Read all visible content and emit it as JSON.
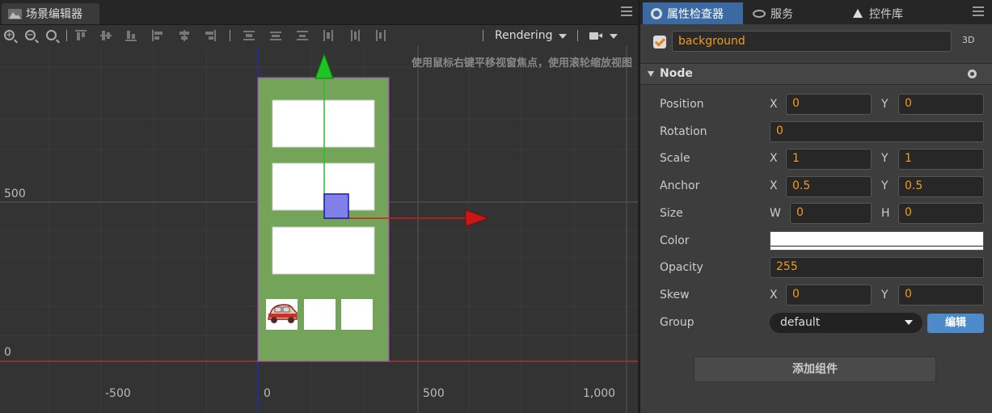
{
  "scene_panel": {
    "tab_label": "场景编辑器",
    "rendering_label": "Rendering",
    "hint": "使用鼠标右键平移视窗焦点，使用滚轮缩放视图",
    "axis": {
      "y_labels": [
        "500",
        "0"
      ],
      "x_labels": [
        "-500",
        "0",
        "500",
        "1,000"
      ]
    },
    "colors": {
      "grid_bg": "#333333",
      "background_node": "#73a45a",
      "x_axis": "#d11a1a",
      "y_axis": "#25c42b"
    }
  },
  "inspector": {
    "tabs": [
      {
        "label": "属性检查器",
        "icon": "gear-icon"
      },
      {
        "label": "服务",
        "icon": "eye-icon"
      },
      {
        "label": "控件库",
        "icon": "triangle-icon"
      }
    ],
    "node_name": "background",
    "tag_3d": "3D",
    "section_title": "Node",
    "props": {
      "position": {
        "label": "Position",
        "x": "0",
        "y": "0"
      },
      "rotation": {
        "label": "Rotation",
        "value": "0"
      },
      "scale": {
        "label": "Scale",
        "x": "1",
        "y": "1"
      },
      "anchor": {
        "label": "Anchor",
        "x": "0.5",
        "y": "0.5"
      },
      "size": {
        "label": "Size",
        "w": "0",
        "h": "0"
      },
      "color": {
        "label": "Color",
        "value": "#ffffff"
      },
      "opacity": {
        "label": "Opacity",
        "value": "255"
      },
      "skew": {
        "label": "Skew",
        "x": "0",
        "y": "0"
      },
      "group": {
        "label": "Group",
        "value": "default",
        "edit": "编辑"
      }
    },
    "axis_letters": {
      "x": "X",
      "y": "Y",
      "w": "W",
      "h": "H"
    },
    "add_component": "添加组件"
  }
}
